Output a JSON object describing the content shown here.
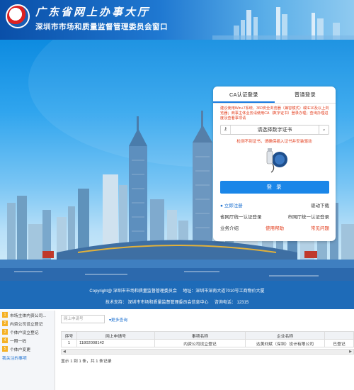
{
  "header": {
    "title": "广东省网上办事大厅",
    "subtitle": "深圳市市场和质量监督管理委员会窗口"
  },
  "login": {
    "tabs": [
      "CA认证登录",
      "普通登录"
    ],
    "notice": "建议使用Win+7系统、360安全浏览器（兼容模式）或IE10及以上浏览器；商事主体业务请使用CA（数字证书）登录办理；查询办理进度及查看事项请",
    "cert_placeholder": "请选择数字证书",
    "cert_warning": "检测不到证书，请确保插入证书并安装驱动",
    "login_button": "登  录",
    "register": "立即注册",
    "driver_download": "驱动下载",
    "provincial_login": "省网厅统一认证登录",
    "city_login": "市网厅统一认证登录",
    "business_intro": "业务介绍",
    "help": "使用帮助",
    "faq": "常见问题"
  },
  "footer": {
    "line1_copyright": "Copyright@ 深圳市市场和质量监督管理委员会",
    "line1_address": "地址：深圳市深南大道7010号工商物价大厦",
    "line2_support": "技术支持：  深圳市市场和质量监督管理委员会信息中心",
    "line2_phone": "咨询电话：  12315"
  },
  "sidebar": {
    "items": [
      {
        "num": "1",
        "label": "市场主体内资公司..."
      },
      {
        "num": "2",
        "label": "内资公司设立登记"
      },
      {
        "num": "3",
        "label": "个体户设立登记"
      },
      {
        "num": "4",
        "label": "一照一码"
      },
      {
        "num": "5",
        "label": "个体户变更"
      }
    ],
    "footer_link": "我关注的事项"
  },
  "search": {
    "placeholder": "网上申请号",
    "more": "更多查询"
  },
  "table": {
    "headers": [
      "序号",
      "网上申请号",
      "事项名称",
      "企业名称",
      ""
    ],
    "rows": [
      [
        "1",
        "11802008142",
        "内资公司设立登记",
        "达美刘斌（深圳）设计有限公司",
        "已登记"
      ]
    ],
    "page_info": "显示 1 到 1 条，共 1 条记录"
  }
}
